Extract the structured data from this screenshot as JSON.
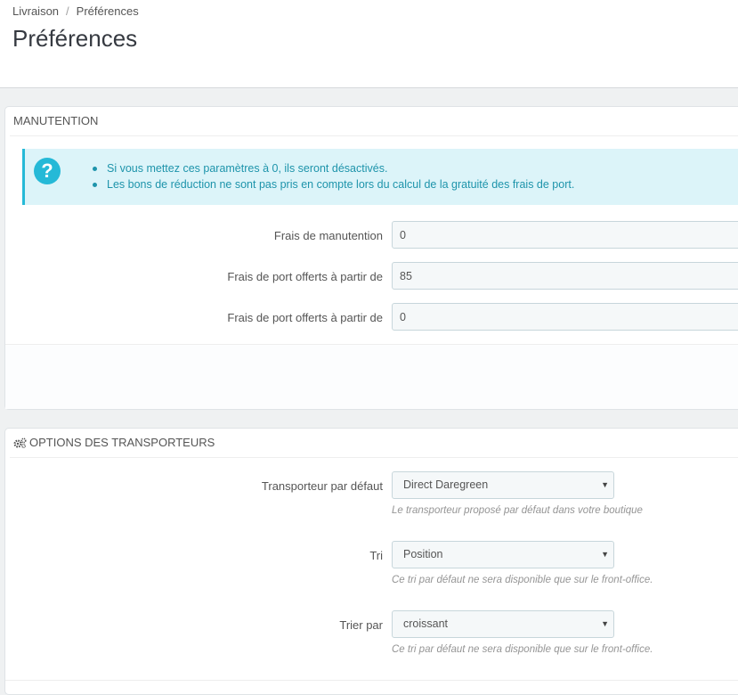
{
  "breadcrumb": {
    "parent": "Livraison",
    "separator": "/",
    "current": "Préférences"
  },
  "page_title": "Préférences",
  "handling_panel": {
    "heading": "MANUTENTION",
    "info_items": [
      "Si vous mettez ces paramètres à 0, ils seront désactivés.",
      "Les bons de réduction ne sont pas pris en compte lors du calcul de la gratuité des frais de port."
    ],
    "fields": [
      {
        "label": "Frais de manutention",
        "value": "0"
      },
      {
        "label": "Frais de port offerts à partir de",
        "value": "85"
      },
      {
        "label": "Frais de port offerts à partir de",
        "value": "0"
      }
    ]
  },
  "carrier_panel": {
    "heading": "OPTIONS DES TRANSPORTEURS",
    "icon": "gears-icon",
    "default_carrier": {
      "label": "Transporteur par défaut",
      "selected": "Direct Daregreen",
      "help": "Le transporteur proposé par défaut dans votre boutique"
    },
    "sort": {
      "label": "Tri",
      "selected": "Position",
      "help": "Ce tri par défaut ne sera disponible que sur le front-office."
    },
    "sort_order": {
      "label": "Trier par",
      "selected": "croissant",
      "help": "Ce tri par défaut ne sera disponible que sur le front-office."
    }
  },
  "colors": {
    "accent": "#25b9d7",
    "info_bg": "#dcf4f9",
    "info_text": "#1e94ab"
  }
}
